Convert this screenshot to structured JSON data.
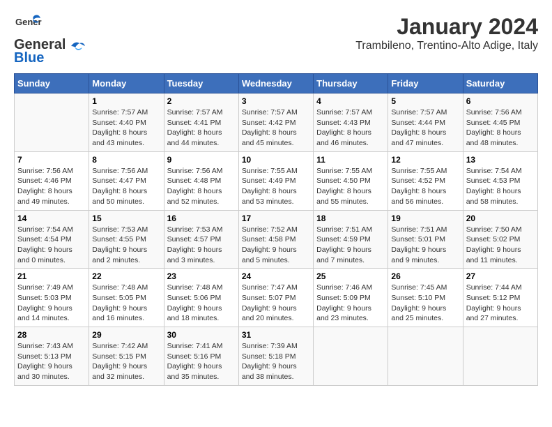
{
  "logo": {
    "general": "General",
    "blue": "Blue"
  },
  "title": "January 2024",
  "subtitle": "Trambileno, Trentino-Alto Adige, Italy",
  "days_of_week": [
    "Sunday",
    "Monday",
    "Tuesday",
    "Wednesday",
    "Thursday",
    "Friday",
    "Saturday"
  ],
  "weeks": [
    [
      {
        "day": "",
        "info": ""
      },
      {
        "day": "1",
        "info": "Sunrise: 7:57 AM\nSunset: 4:40 PM\nDaylight: 8 hours\nand 43 minutes."
      },
      {
        "day": "2",
        "info": "Sunrise: 7:57 AM\nSunset: 4:41 PM\nDaylight: 8 hours\nand 44 minutes."
      },
      {
        "day": "3",
        "info": "Sunrise: 7:57 AM\nSunset: 4:42 PM\nDaylight: 8 hours\nand 45 minutes."
      },
      {
        "day": "4",
        "info": "Sunrise: 7:57 AM\nSunset: 4:43 PM\nDaylight: 8 hours\nand 46 minutes."
      },
      {
        "day": "5",
        "info": "Sunrise: 7:57 AM\nSunset: 4:44 PM\nDaylight: 8 hours\nand 47 minutes."
      },
      {
        "day": "6",
        "info": "Sunrise: 7:56 AM\nSunset: 4:45 PM\nDaylight: 8 hours\nand 48 minutes."
      }
    ],
    [
      {
        "day": "7",
        "info": "Sunrise: 7:56 AM\nSunset: 4:46 PM\nDaylight: 8 hours\nand 49 minutes."
      },
      {
        "day": "8",
        "info": "Sunrise: 7:56 AM\nSunset: 4:47 PM\nDaylight: 8 hours\nand 50 minutes."
      },
      {
        "day": "9",
        "info": "Sunrise: 7:56 AM\nSunset: 4:48 PM\nDaylight: 8 hours\nand 52 minutes."
      },
      {
        "day": "10",
        "info": "Sunrise: 7:55 AM\nSunset: 4:49 PM\nDaylight: 8 hours\nand 53 minutes."
      },
      {
        "day": "11",
        "info": "Sunrise: 7:55 AM\nSunset: 4:50 PM\nDaylight: 8 hours\nand 55 minutes."
      },
      {
        "day": "12",
        "info": "Sunrise: 7:55 AM\nSunset: 4:52 PM\nDaylight: 8 hours\nand 56 minutes."
      },
      {
        "day": "13",
        "info": "Sunrise: 7:54 AM\nSunset: 4:53 PM\nDaylight: 8 hours\nand 58 minutes."
      }
    ],
    [
      {
        "day": "14",
        "info": "Sunrise: 7:54 AM\nSunset: 4:54 PM\nDaylight: 9 hours\nand 0 minutes."
      },
      {
        "day": "15",
        "info": "Sunrise: 7:53 AM\nSunset: 4:55 PM\nDaylight: 9 hours\nand 2 minutes."
      },
      {
        "day": "16",
        "info": "Sunrise: 7:53 AM\nSunset: 4:57 PM\nDaylight: 9 hours\nand 3 minutes."
      },
      {
        "day": "17",
        "info": "Sunrise: 7:52 AM\nSunset: 4:58 PM\nDaylight: 9 hours\nand 5 minutes."
      },
      {
        "day": "18",
        "info": "Sunrise: 7:51 AM\nSunset: 4:59 PM\nDaylight: 9 hours\nand 7 minutes."
      },
      {
        "day": "19",
        "info": "Sunrise: 7:51 AM\nSunset: 5:01 PM\nDaylight: 9 hours\nand 9 minutes."
      },
      {
        "day": "20",
        "info": "Sunrise: 7:50 AM\nSunset: 5:02 PM\nDaylight: 9 hours\nand 11 minutes."
      }
    ],
    [
      {
        "day": "21",
        "info": "Sunrise: 7:49 AM\nSunset: 5:03 PM\nDaylight: 9 hours\nand 14 minutes."
      },
      {
        "day": "22",
        "info": "Sunrise: 7:48 AM\nSunset: 5:05 PM\nDaylight: 9 hours\nand 16 minutes."
      },
      {
        "day": "23",
        "info": "Sunrise: 7:48 AM\nSunset: 5:06 PM\nDaylight: 9 hours\nand 18 minutes."
      },
      {
        "day": "24",
        "info": "Sunrise: 7:47 AM\nSunset: 5:07 PM\nDaylight: 9 hours\nand 20 minutes."
      },
      {
        "day": "25",
        "info": "Sunrise: 7:46 AM\nSunset: 5:09 PM\nDaylight: 9 hours\nand 23 minutes."
      },
      {
        "day": "26",
        "info": "Sunrise: 7:45 AM\nSunset: 5:10 PM\nDaylight: 9 hours\nand 25 minutes."
      },
      {
        "day": "27",
        "info": "Sunrise: 7:44 AM\nSunset: 5:12 PM\nDaylight: 9 hours\nand 27 minutes."
      }
    ],
    [
      {
        "day": "28",
        "info": "Sunrise: 7:43 AM\nSunset: 5:13 PM\nDaylight: 9 hours\nand 30 minutes."
      },
      {
        "day": "29",
        "info": "Sunrise: 7:42 AM\nSunset: 5:15 PM\nDaylight: 9 hours\nand 32 minutes."
      },
      {
        "day": "30",
        "info": "Sunrise: 7:41 AM\nSunset: 5:16 PM\nDaylight: 9 hours\nand 35 minutes."
      },
      {
        "day": "31",
        "info": "Sunrise: 7:39 AM\nSunset: 5:18 PM\nDaylight: 9 hours\nand 38 minutes."
      },
      {
        "day": "",
        "info": ""
      },
      {
        "day": "",
        "info": ""
      },
      {
        "day": "",
        "info": ""
      }
    ]
  ]
}
